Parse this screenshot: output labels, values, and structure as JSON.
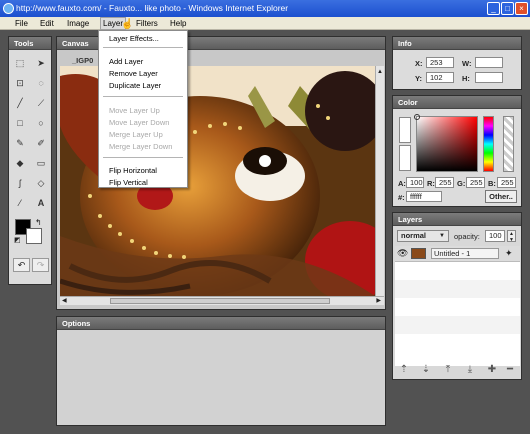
{
  "window": {
    "title": "http://www.fauxto.com/ - Fauxto... like photo - Windows Internet Explorer",
    "min": "_",
    "max": "□",
    "close": "×"
  },
  "menu": {
    "file": "File",
    "edit": "Edit",
    "image": "Image",
    "layer": "Layer",
    "filters": "Filters",
    "help": "Help"
  },
  "tools": {
    "title": "Tools"
  },
  "canvas": {
    "title": "Canvas",
    "tab": "_IGP0"
  },
  "options": {
    "title": "Options"
  },
  "layer_menu": {
    "effects": "Layer Effects...",
    "add": "Add Layer",
    "remove": "Remove Layer",
    "duplicate": "Duplicate Layer",
    "move_up": "Move Layer Up",
    "move_down": "Move Layer Down",
    "merge_up": "Merge Layer Up",
    "merge_down": "Merge Layer Down",
    "flip_h": "Flip Horizontal",
    "flip_v": "Flip Vertical"
  },
  "info": {
    "title": "Info",
    "x_label": "X:",
    "x_value": "253",
    "y_label": "Y:",
    "y_value": "102",
    "w_label": "W:",
    "w_value": "",
    "h_label": "H:",
    "h_value": ""
  },
  "color": {
    "title": "Color",
    "a_label": "A:",
    "a_value": "100",
    "r_label": "R:",
    "r_value": "255",
    "g_label": "G:",
    "g_value": "255",
    "b_label": "B:",
    "b_value": "255",
    "hex_label": "#:",
    "hex_value": "ffffff",
    "other_button": "Other.."
  },
  "layers": {
    "title": "Layers",
    "blend_mode": "normal",
    "opacity_label": "opacity:",
    "opacity_value": "100",
    "items": [
      {
        "name": "Untitled - 1"
      }
    ]
  },
  "colors": {
    "titlebar": "#1c4fcf",
    "panel_header": "#6b6b6b",
    "selection": "#dcdcdc"
  }
}
